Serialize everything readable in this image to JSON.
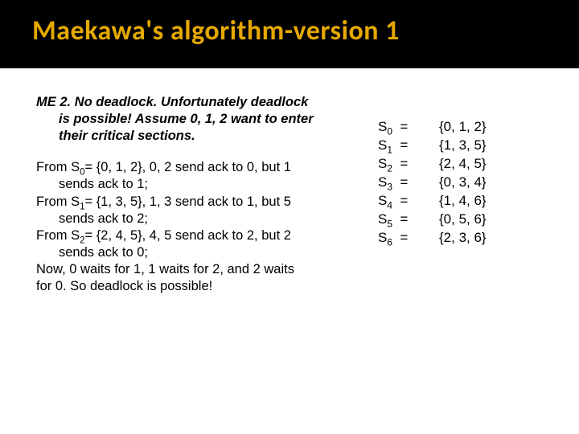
{
  "title": "Maekawa's algorithm-version 1",
  "left": {
    "me2_line1": "ME 2. No deadlock. Unfortunately deadlock",
    "me2_line2": "is possible! Assume 0, 1, 2 want to enter",
    "me2_line3": "their critical sections.",
    "from_s0_pre": "From ",
    "from_s0_label": "S",
    "from_s0_sub": "0",
    "from_s0_rest": "= {0, 1, 2}, 0, 2 send ack to 0, but 1",
    "from_s0_line2": "sends ack to 1;",
    "from_s1_pre": "From ",
    "from_s1_label": "S",
    "from_s1_sub": "1",
    "from_s1_rest": "= {1, 3, 5}, 1, 3 send ack to 1, but 5",
    "from_s1_line2": "sends ack to 2;",
    "from_s2_pre": "From ",
    "from_s2_label": "S",
    "from_s2_sub": "2",
    "from_s2_rest": "= {2, 4, 5}, 4, 5 send ack to 2, but 2",
    "from_s2_line2": "sends ack to 0;",
    "now_line1": "Now, 0 waits for 1, 1 waits for 2, and 2 waits",
    "now_line2": "for 0. So deadlock is possible!"
  },
  "sets": {
    "S_letter": "S",
    "rows": [
      {
        "sub": "0",
        "eq": "=",
        "val": "{0, 1, 2}"
      },
      {
        "sub": "1",
        "eq": "=",
        "val": "{1, 3, 5}"
      },
      {
        "sub": "2",
        "eq": "=",
        "val": "{2, 4, 5}"
      },
      {
        "sub": "3",
        "eq": "=",
        "val": "{0, 3, 4}"
      },
      {
        "sub": "4",
        "eq": "=",
        "val": "{1, 4, 6}"
      },
      {
        "sub": "5",
        "eq": "=",
        "val": "{0, 5, 6}"
      },
      {
        "sub": "6",
        "eq": "=",
        "val": "{2, 3, 6}"
      }
    ]
  }
}
